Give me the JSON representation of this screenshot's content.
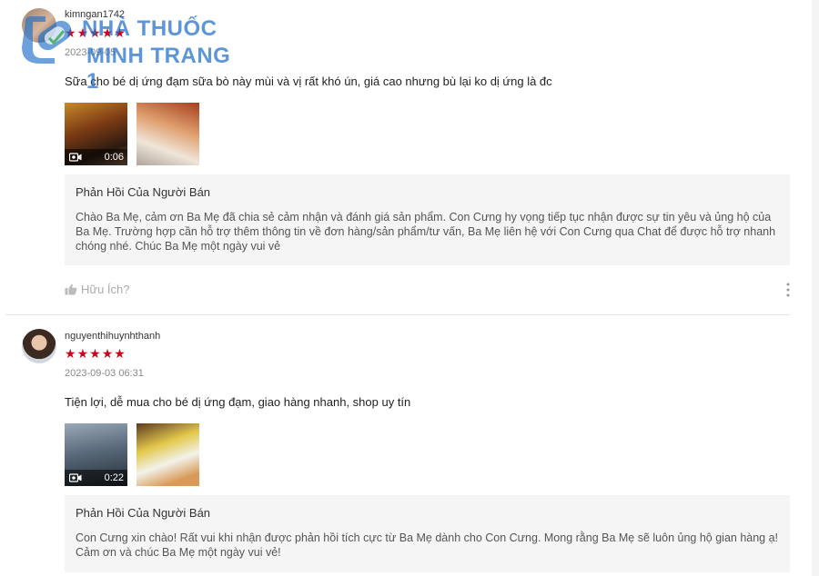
{
  "watermark": {
    "line1": "NHÀ THUỐC",
    "line2": "MINH TRANG 1"
  },
  "reviews": [
    {
      "username": "kimngan1742",
      "rating": 5,
      "date": "2023-09-05",
      "comment": "Sữa cho bé dị ứng đạm sữa bò này mùi và vị rất khó ún, giá cao nhưng bù lại ko dị ứng là đc",
      "media": [
        {
          "type": "video",
          "duration": "0:06"
        },
        {
          "type": "image"
        }
      ],
      "seller_reply": {
        "title": "Phản Hồi Của Người Bán",
        "body": "Chào Ba Mẹ, cảm ơn Ba Mẹ đã chia sẻ cảm nhận và đánh giá sản phẩm. Con Cưng hy vọng tiếp tục nhận được sự tin yêu và ủng hộ của Ba Mẹ. Trường hợp cần hỗ trợ thêm thông tin về đơn hàng/sản phẩm/tư vấn, Ba Mẹ liên hệ với Con Cưng qua Chat để được hỗ trợ nhanh chóng nhé. Chúc Ba Mẹ một ngày vui vẻ"
      },
      "helpful_label": "Hữu Ích?"
    },
    {
      "username": "nguyenthihuynhthanh",
      "rating": 5,
      "date": "2023-09-03 06:31",
      "comment": "Tiện lợi, dễ mua cho bé dị ứng đạm, giao hàng nhanh, shop uy tín",
      "media": [
        {
          "type": "video",
          "duration": "0:22"
        },
        {
          "type": "image"
        }
      ],
      "seller_reply": {
        "title": "Phản Hồi Của Người Bán",
        "body": "Con Cưng xin chào! Rất vui khi nhận được phản hồi tích cực từ Ba Mẹ dành cho Con Cưng. Mong rằng Ba Mẹ sẽ luôn ủng hộ gian hàng ạ! Cảm ơn và chúc Ba Mẹ một ngày vui vẻ!"
      }
    }
  ],
  "colors": {
    "star": "#d0021b",
    "reply_bg": "#f5f5f5",
    "watermark": "#1e6ec8"
  },
  "icons": {
    "helpful": "thumbs-up-icon",
    "more": "more-vertical-icon",
    "video": "video-camera-icon"
  }
}
